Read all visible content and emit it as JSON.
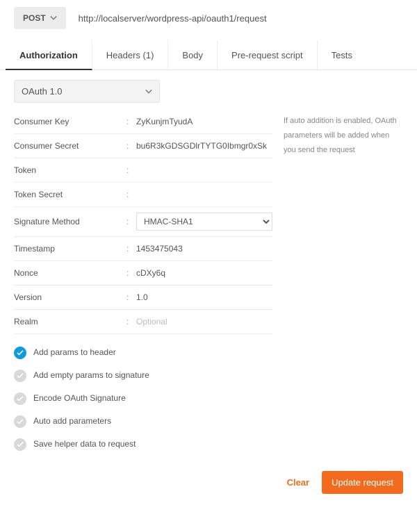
{
  "request": {
    "method": "POST",
    "url": "http://localserver/wordpress-api/oauth1/request"
  },
  "tabs": [
    {
      "label": "Authorization",
      "active": true
    },
    {
      "label": "Headers (1)",
      "active": false
    },
    {
      "label": "Body",
      "active": false
    },
    {
      "label": "Pre-request script",
      "active": false
    },
    {
      "label": "Tests",
      "active": false
    }
  ],
  "auth": {
    "type_label": "OAuth 1.0",
    "fields": {
      "consumer_key": {
        "label": "Consumer Key",
        "value": "ZyKunjmTyudA"
      },
      "consumer_secret": {
        "label": "Consumer Secret",
        "value": "bu6R3kGDSGDlrTYTG0Ibmgr0xSk"
      },
      "token": {
        "label": "Token",
        "value": ""
      },
      "token_secret": {
        "label": "Token Secret",
        "value": ""
      },
      "signature_method": {
        "label": "Signature Method",
        "value": "HMAC-SHA1"
      },
      "timestamp": {
        "label": "Timestamp",
        "value": "1453475043"
      },
      "nonce": {
        "label": "Nonce",
        "value": "cDXy6q"
      },
      "version": {
        "label": "Version",
        "value": "1.0"
      },
      "realm": {
        "label": "Realm",
        "value": "",
        "placeholder": "Optional"
      }
    },
    "options": {
      "add_params_header": {
        "label": "Add params to header",
        "checked": true
      },
      "add_empty_params": {
        "label": "Add empty params to signature",
        "checked": false
      },
      "encode_signature": {
        "label": "Encode OAuth Signature",
        "checked": false
      },
      "auto_add_params": {
        "label": "Auto add parameters",
        "checked": false
      },
      "save_helper_data": {
        "label": "Save helper data to request",
        "checked": false
      }
    },
    "help_text": "If auto addition is enabled, OAuth parameters will be added when you send the request"
  },
  "actions": {
    "clear": "Clear",
    "update": "Update request"
  }
}
